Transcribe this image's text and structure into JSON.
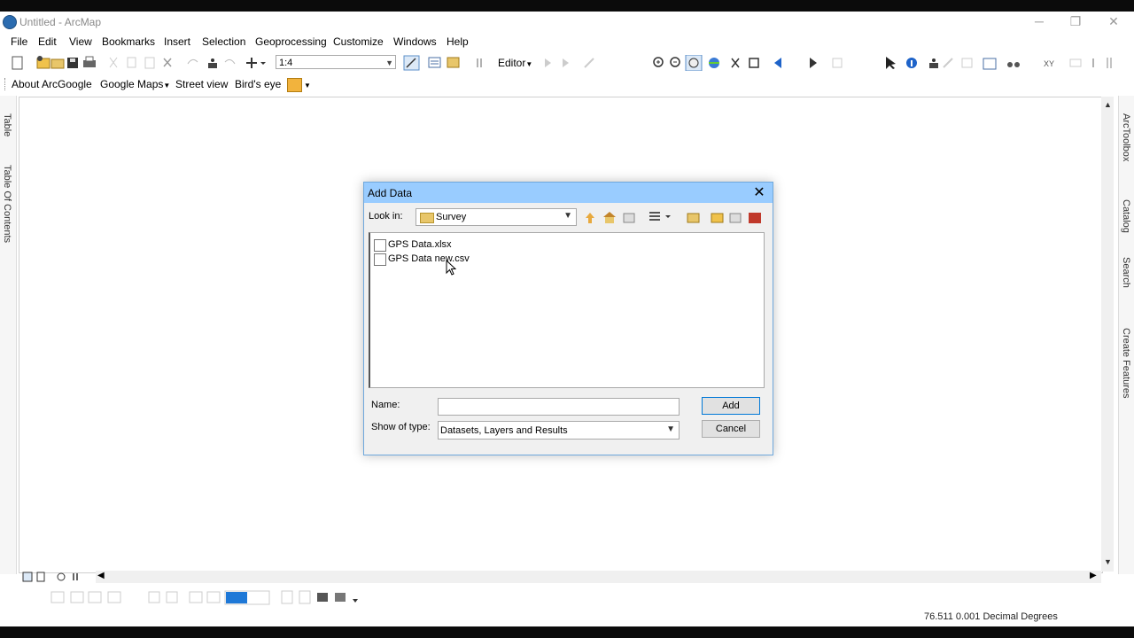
{
  "window": {
    "title": "Untitled - ArcMap",
    "minimize": "─",
    "restore": "❐",
    "close": "✕"
  },
  "menu": [
    "File",
    "Edit",
    "View",
    "Bookmarks",
    "Insert",
    "Selection",
    "Geoprocessing",
    "Customize",
    "Windows",
    "Help"
  ],
  "toolbar": {
    "scale": "1:4",
    "editor_label": "Editor"
  },
  "toolbar2": {
    "about": "About ArcGoogle",
    "google_maps": "Google Maps",
    "street_view": "Street view",
    "birds_eye": "Bird's eye"
  },
  "left_dock": {
    "table": "Table",
    "toc": "Table Of Contents"
  },
  "right_dock": {
    "toolbox": "ArcToolbox",
    "catalog": "Catalog",
    "search": "Search",
    "create_features": "Create Features"
  },
  "dialog": {
    "title": "Add Data",
    "look_in_label": "Look in:",
    "look_in_value": "Survey",
    "files": [
      "GPS Data.xlsx",
      "GPS Data new.csv"
    ],
    "name_label": "Name:",
    "name_value": "",
    "type_label": "Show of type:",
    "type_value": "Datasets, Layers and Results",
    "add_label": "Add",
    "cancel_label": "Cancel"
  },
  "status": {
    "coordinates": "76.511  0.001 Decimal Degrees"
  },
  "colors": {
    "dialog_title": "#99ccff",
    "accent": "#0078d7"
  }
}
